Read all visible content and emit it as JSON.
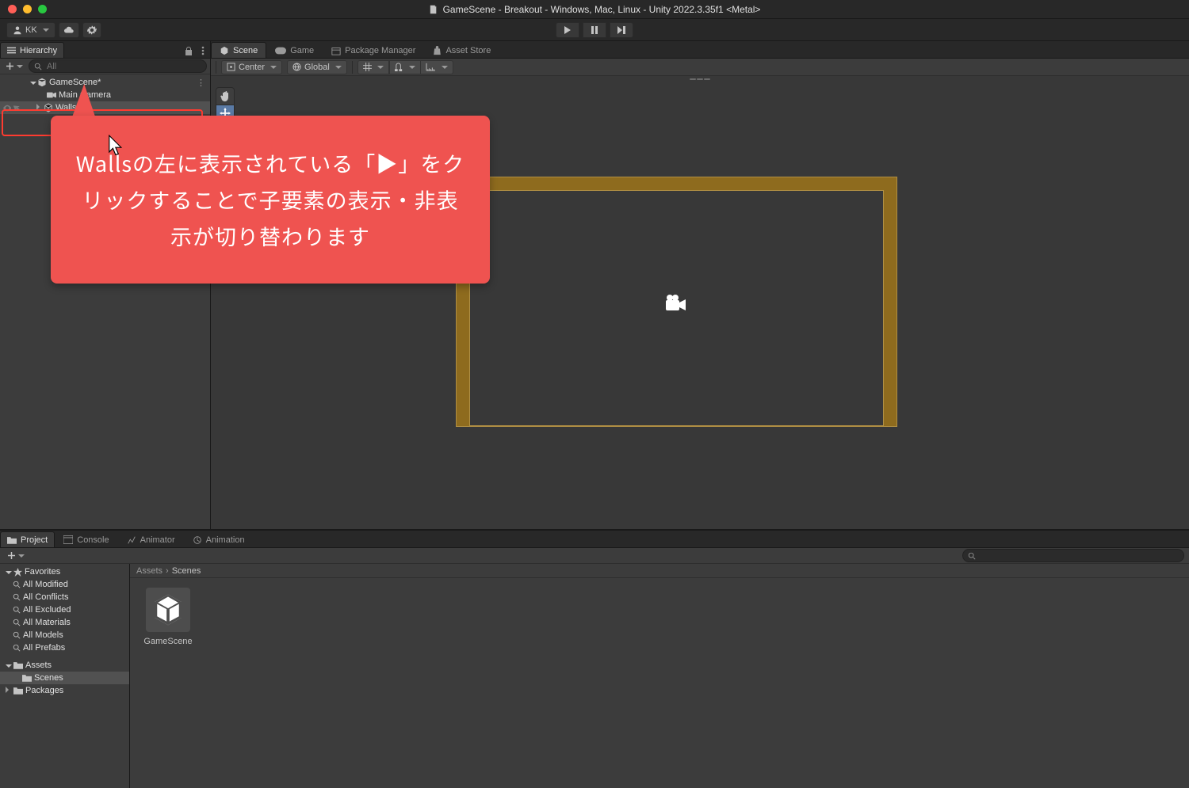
{
  "window": {
    "title": "GameScene - Breakout - Windows, Mac, Linux - Unity 2022.3.35f1 <Metal>"
  },
  "toolbar": {
    "account_label": "KK",
    "play_controls": [
      "play",
      "pause",
      "step"
    ]
  },
  "hierarchy": {
    "panel_title": "Hierarchy",
    "search_placeholder": "All",
    "scene_name": "GameScene*",
    "items": [
      {
        "name": "Main Camera"
      },
      {
        "name": "Walls"
      }
    ]
  },
  "scene_tabs": [
    {
      "label": "Scene",
      "icon": "scene"
    },
    {
      "label": "Game",
      "icon": "game"
    },
    {
      "label": "Package Manager",
      "icon": "package"
    },
    {
      "label": "Asset Store",
      "icon": "store"
    }
  ],
  "scene_toolbar": {
    "pivot": "Center",
    "handle": "Global"
  },
  "callout_text": "Wallsの左に表示されている「▶」をクリックすることで子要素の表示・非表示が切り替わります",
  "bottom_tabs": [
    {
      "label": "Project"
    },
    {
      "label": "Console"
    },
    {
      "label": "Animator"
    },
    {
      "label": "Animation"
    }
  ],
  "project_tree": {
    "favorites_label": "Favorites",
    "favorites": [
      "All Modified",
      "All Conflicts",
      "All Excluded",
      "All Materials",
      "All Models",
      "All Prefabs"
    ],
    "assets_label": "Assets",
    "assets_children": [
      "Scenes"
    ],
    "packages_label": "Packages"
  },
  "breadcrumb": [
    "Assets",
    "Scenes"
  ],
  "assets": [
    {
      "name": "GameScene"
    }
  ]
}
